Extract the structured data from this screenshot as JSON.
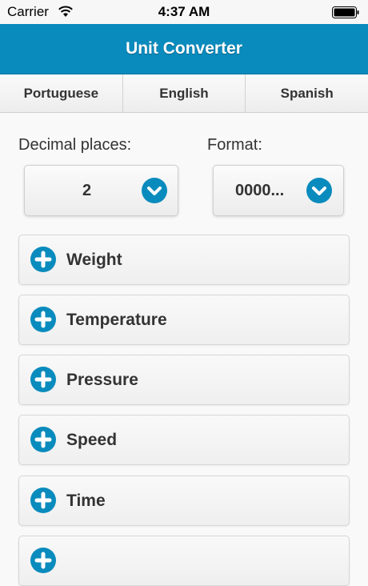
{
  "status": {
    "carrier": "Carrier",
    "time": "4:37 AM"
  },
  "header": {
    "title": "Unit Converter"
  },
  "tabs": [
    {
      "label": "Portuguese"
    },
    {
      "label": "English"
    },
    {
      "label": "Spanish"
    }
  ],
  "settings": {
    "decimal_label": "Decimal places:",
    "decimal_value": "2",
    "format_label": "Format:",
    "format_value": "0000..."
  },
  "categories": [
    {
      "label": "Weight"
    },
    {
      "label": "Temperature"
    },
    {
      "label": "Pressure"
    },
    {
      "label": "Speed"
    },
    {
      "label": "Time"
    },
    {
      "label": ""
    }
  ],
  "colors": {
    "accent": "#0a8bbd"
  }
}
